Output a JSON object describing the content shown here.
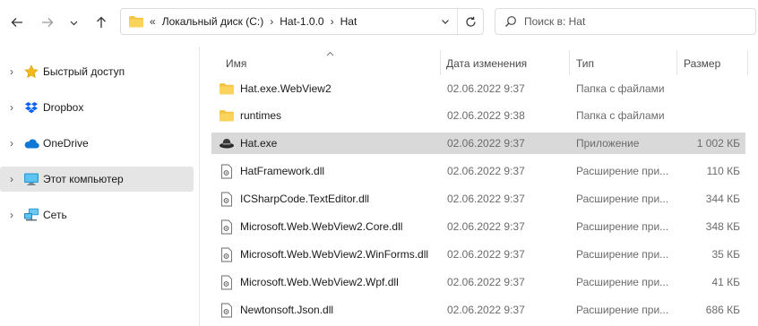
{
  "address": {
    "overflow": "«",
    "crumbs": [
      "Локальный диск (C:)",
      "Hat-1.0.0",
      "Hat"
    ]
  },
  "search": {
    "placeholder": "Поиск в: Hat"
  },
  "sidebar": {
    "items": [
      {
        "label": "Быстрый доступ",
        "icon": "star-icon"
      },
      {
        "label": "Dropbox",
        "icon": "dropbox-icon"
      },
      {
        "label": "OneDrive",
        "icon": "onedrive-cloud-icon"
      },
      {
        "label": "Этот компьютер",
        "icon": "computer-icon",
        "selected": true
      },
      {
        "label": "Сеть",
        "icon": "network-icon"
      }
    ]
  },
  "columns": {
    "name": "Имя",
    "date": "Дата изменения",
    "type": "Тип",
    "size": "Размер"
  },
  "files": [
    {
      "name": "Hat.exe.WebView2",
      "date": "02.06.2022 9:37",
      "type": "Папка с файлами",
      "size": "",
      "icon": "folder-icon"
    },
    {
      "name": "runtimes",
      "date": "02.06.2022 9:38",
      "type": "Папка с файлами",
      "size": "",
      "icon": "folder-icon"
    },
    {
      "name": "Hat.exe",
      "date": "02.06.2022 9:37",
      "type": "Приложение",
      "size": "1 002 КБ",
      "icon": "hat-app-icon",
      "selected": true
    },
    {
      "name": "HatFramework.dll",
      "date": "02.06.2022 9:37",
      "type": "Расширение при...",
      "size": "110 КБ",
      "icon": "dll-file-icon"
    },
    {
      "name": "ICSharpCode.TextEditor.dll",
      "date": "02.06.2022 9:37",
      "type": "Расширение при...",
      "size": "344 КБ",
      "icon": "dll-file-icon"
    },
    {
      "name": "Microsoft.Web.WebView2.Core.dll",
      "date": "02.06.2022 9:37",
      "type": "Расширение при...",
      "size": "348 КБ",
      "icon": "dll-file-icon"
    },
    {
      "name": "Microsoft.Web.WebView2.WinForms.dll",
      "date": "02.06.2022 9:37",
      "type": "Расширение при...",
      "size": "35 КБ",
      "icon": "dll-file-icon"
    },
    {
      "name": "Microsoft.Web.WebView2.Wpf.dll",
      "date": "02.06.2022 9:37",
      "type": "Расширение при...",
      "size": "41 КБ",
      "icon": "dll-file-icon"
    },
    {
      "name": "Newtonsoft.Json.dll",
      "date": "02.06.2022 9:37",
      "type": "Расширение при...",
      "size": "686 КБ",
      "icon": "dll-file-icon"
    }
  ]
}
